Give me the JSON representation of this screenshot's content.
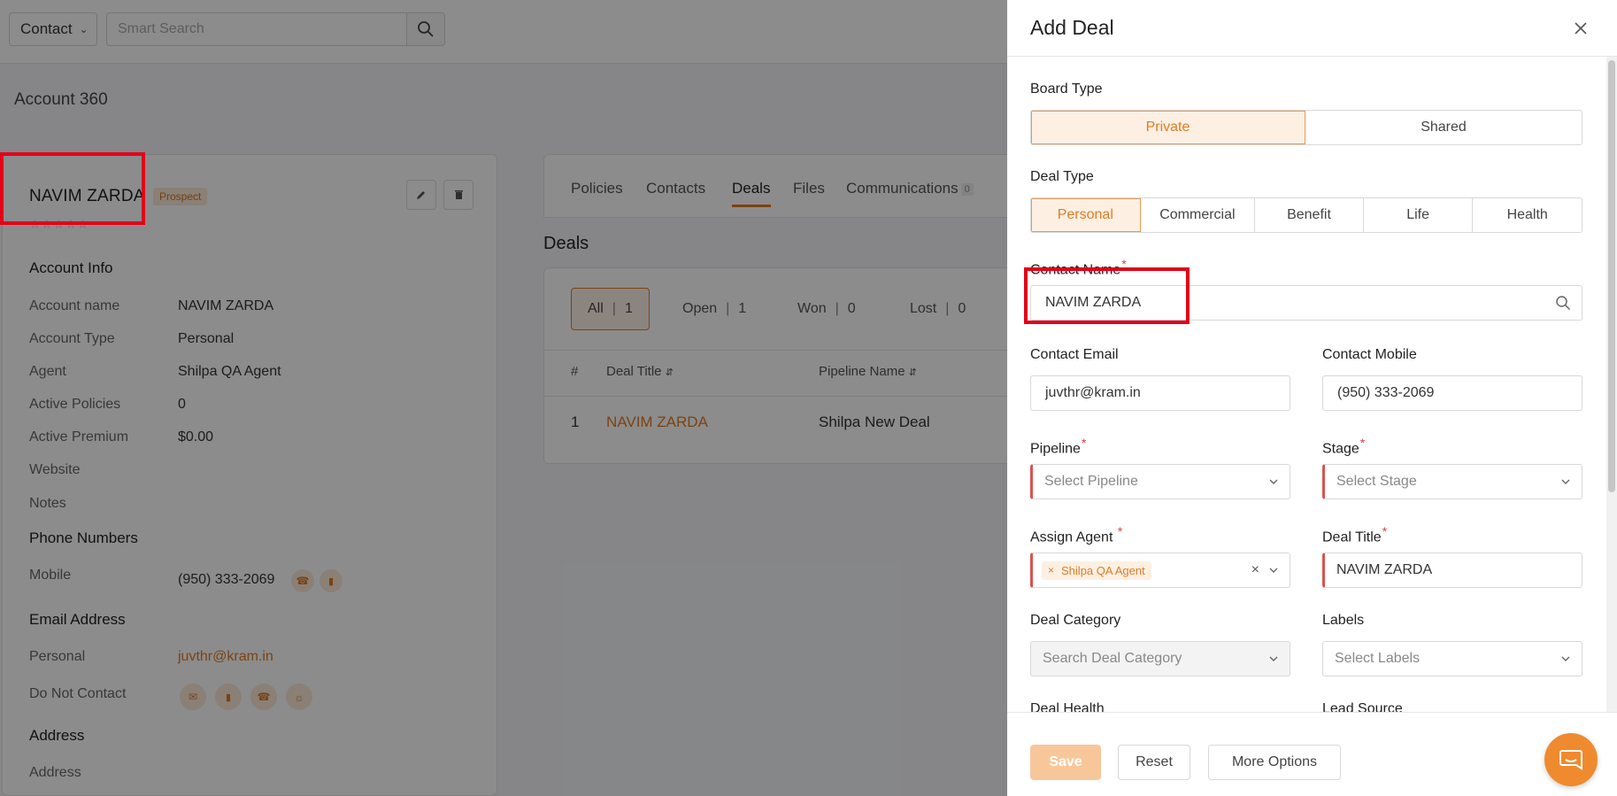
{
  "topbar": {
    "context_label": "Contact",
    "search_placeholder": "Smart Search"
  },
  "page": {
    "title": "Account 360"
  },
  "account": {
    "name": "NAVIM ZARDA",
    "status_badge": "Prospect",
    "stars": "☆☆☆☆☆",
    "sections": {
      "account_info": "Account Info",
      "phone_numbers": "Phone Numbers",
      "email_address": "Email Address",
      "address": "Address"
    },
    "fields": [
      {
        "label": "Account name",
        "value": "NAVIM ZARDA"
      },
      {
        "label": "Account Type",
        "value": "Personal"
      },
      {
        "label": "Agent",
        "value": "Shilpa QA Agent"
      },
      {
        "label": "Active Policies",
        "value": "0"
      },
      {
        "label": "Active Premium",
        "value": "$0.00"
      },
      {
        "label": "Website",
        "value": ""
      },
      {
        "label": "Notes",
        "value": ""
      }
    ],
    "phone": {
      "label": "Mobile",
      "value": "(950) 333-2069"
    },
    "email": {
      "label": "Personal",
      "value": "juvthr@kram.in"
    },
    "do_not_contact": {
      "label": "Do Not Contact"
    },
    "address": {
      "label": "Address"
    }
  },
  "tabs": [
    {
      "label": "Policies"
    },
    {
      "label": "Contacts"
    },
    {
      "label": "Deals"
    },
    {
      "label": "Files"
    },
    {
      "label": "Communications",
      "count": "0"
    }
  ],
  "deals": {
    "title": "Deals",
    "filters": [
      {
        "label": "All",
        "count": "1"
      },
      {
        "label": "Open",
        "count": "1"
      },
      {
        "label": "Won",
        "count": "0"
      },
      {
        "label": "Lost",
        "count": "0"
      }
    ],
    "columns": [
      "#",
      "Deal Title",
      "Pipeline Name"
    ],
    "rows": [
      {
        "num": "1",
        "title": "NAVIM ZARDA",
        "pipeline": "Shilpa New Deal"
      }
    ]
  },
  "drawer": {
    "title": "Add Deal",
    "board_type": {
      "label": "Board Type",
      "options": [
        "Private",
        "Shared"
      ],
      "selected": "Private"
    },
    "deal_type": {
      "label": "Deal Type",
      "options": [
        "Personal",
        "Commercial",
        "Benefit",
        "Life",
        "Health"
      ],
      "selected": "Personal"
    },
    "contact_name": {
      "label": "Contact Name",
      "value": "NAVIM ZARDA"
    },
    "contact_email": {
      "label": "Contact Email",
      "value": "juvthr@kram.in"
    },
    "contact_mobile": {
      "label": "Contact Mobile",
      "value": "(950) 333-2069"
    },
    "pipeline": {
      "label": "Pipeline",
      "placeholder": "Select Pipeline"
    },
    "stage": {
      "label": "Stage",
      "placeholder": "Select Stage"
    },
    "assign_agent": {
      "label": "Assign Agent",
      "chip": "Shilpa QA Agent"
    },
    "deal_title": {
      "label": "Deal Title",
      "value": "NAVIM ZARDA"
    },
    "deal_category": {
      "label": "Deal Category",
      "placeholder": "Search Deal Category"
    },
    "labels": {
      "label": "Labels",
      "placeholder": "Select Labels"
    },
    "deal_health": {
      "label": "Deal Health"
    },
    "lead_source": {
      "label": "Lead Source"
    },
    "required_mark": "*",
    "buttons": {
      "save": "Save",
      "reset": "Reset",
      "more": "More Options"
    }
  },
  "colors": {
    "accent": "#e07b26",
    "highlight": "#e3001b"
  }
}
